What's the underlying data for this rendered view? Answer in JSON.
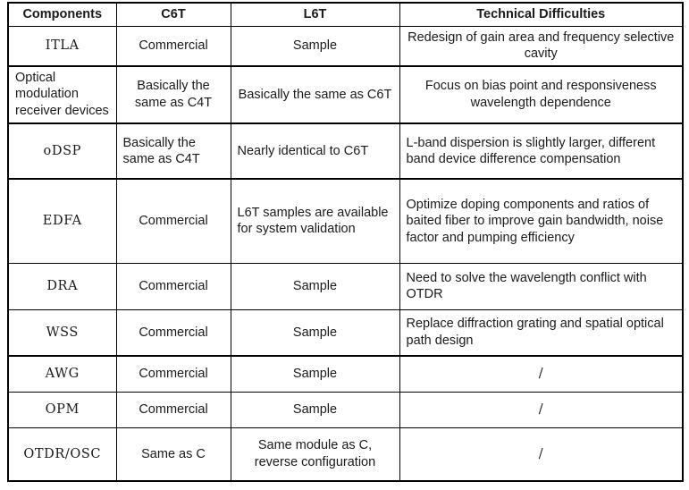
{
  "table": {
    "headers": [
      {
        "label": "Components"
      },
      {
        "label": "C6T"
      },
      {
        "label": "L6T"
      },
      {
        "label": "Technical Difficulties"
      }
    ],
    "rows": [
      {
        "component": "ITLA",
        "c6t": "Commercial",
        "l6t": "Sample",
        "tech": "Redesign of gain area and frequency selective cavity"
      },
      {
        "component": "Optical modulation receiver devices",
        "c6t": "Basically the same as C4T",
        "l6t": "Basically the same as C6T",
        "tech": "Focus on bias point and responsiveness wavelength dependence"
      },
      {
        "component": "oDSP",
        "c6t": "Basically the same as C4T",
        "l6t": "Nearly identical to C6T",
        "tech": "L-band dispersion is slightly larger, different band device difference compensation"
      },
      {
        "component": "EDFA",
        "c6t": "Commercial",
        "l6t": "L6T samples are available for system validation",
        "tech": "Optimize doping components and ratios of baited fiber to improve gain bandwidth, noise factor and pumping efficiency"
      },
      {
        "component": "DRA",
        "c6t": "Commercial",
        "l6t": "Sample",
        "tech": "Need to solve the wavelength conflict with OTDR"
      },
      {
        "component": "WSS",
        "c6t": "Commercial",
        "l6t": "Sample",
        "tech": "Replace diffraction grating and spatial optical path design"
      },
      {
        "component": "AWG",
        "c6t": "Commercial",
        "l6t": "Sample",
        "tech": "/"
      },
      {
        "component": "OPM",
        "c6t": "Commercial",
        "l6t": "Sample",
        "tech": "/"
      },
      {
        "component": "OTDR/OSC",
        "c6t": "Same as C",
        "l6t": "Same module as C, reverse configuration",
        "tech": "/"
      }
    ]
  },
  "colors": {
    "border": "#000000",
    "text": "#1a1a1a",
    "muted": "#9a9a9a",
    "background": "#ffffff"
  }
}
